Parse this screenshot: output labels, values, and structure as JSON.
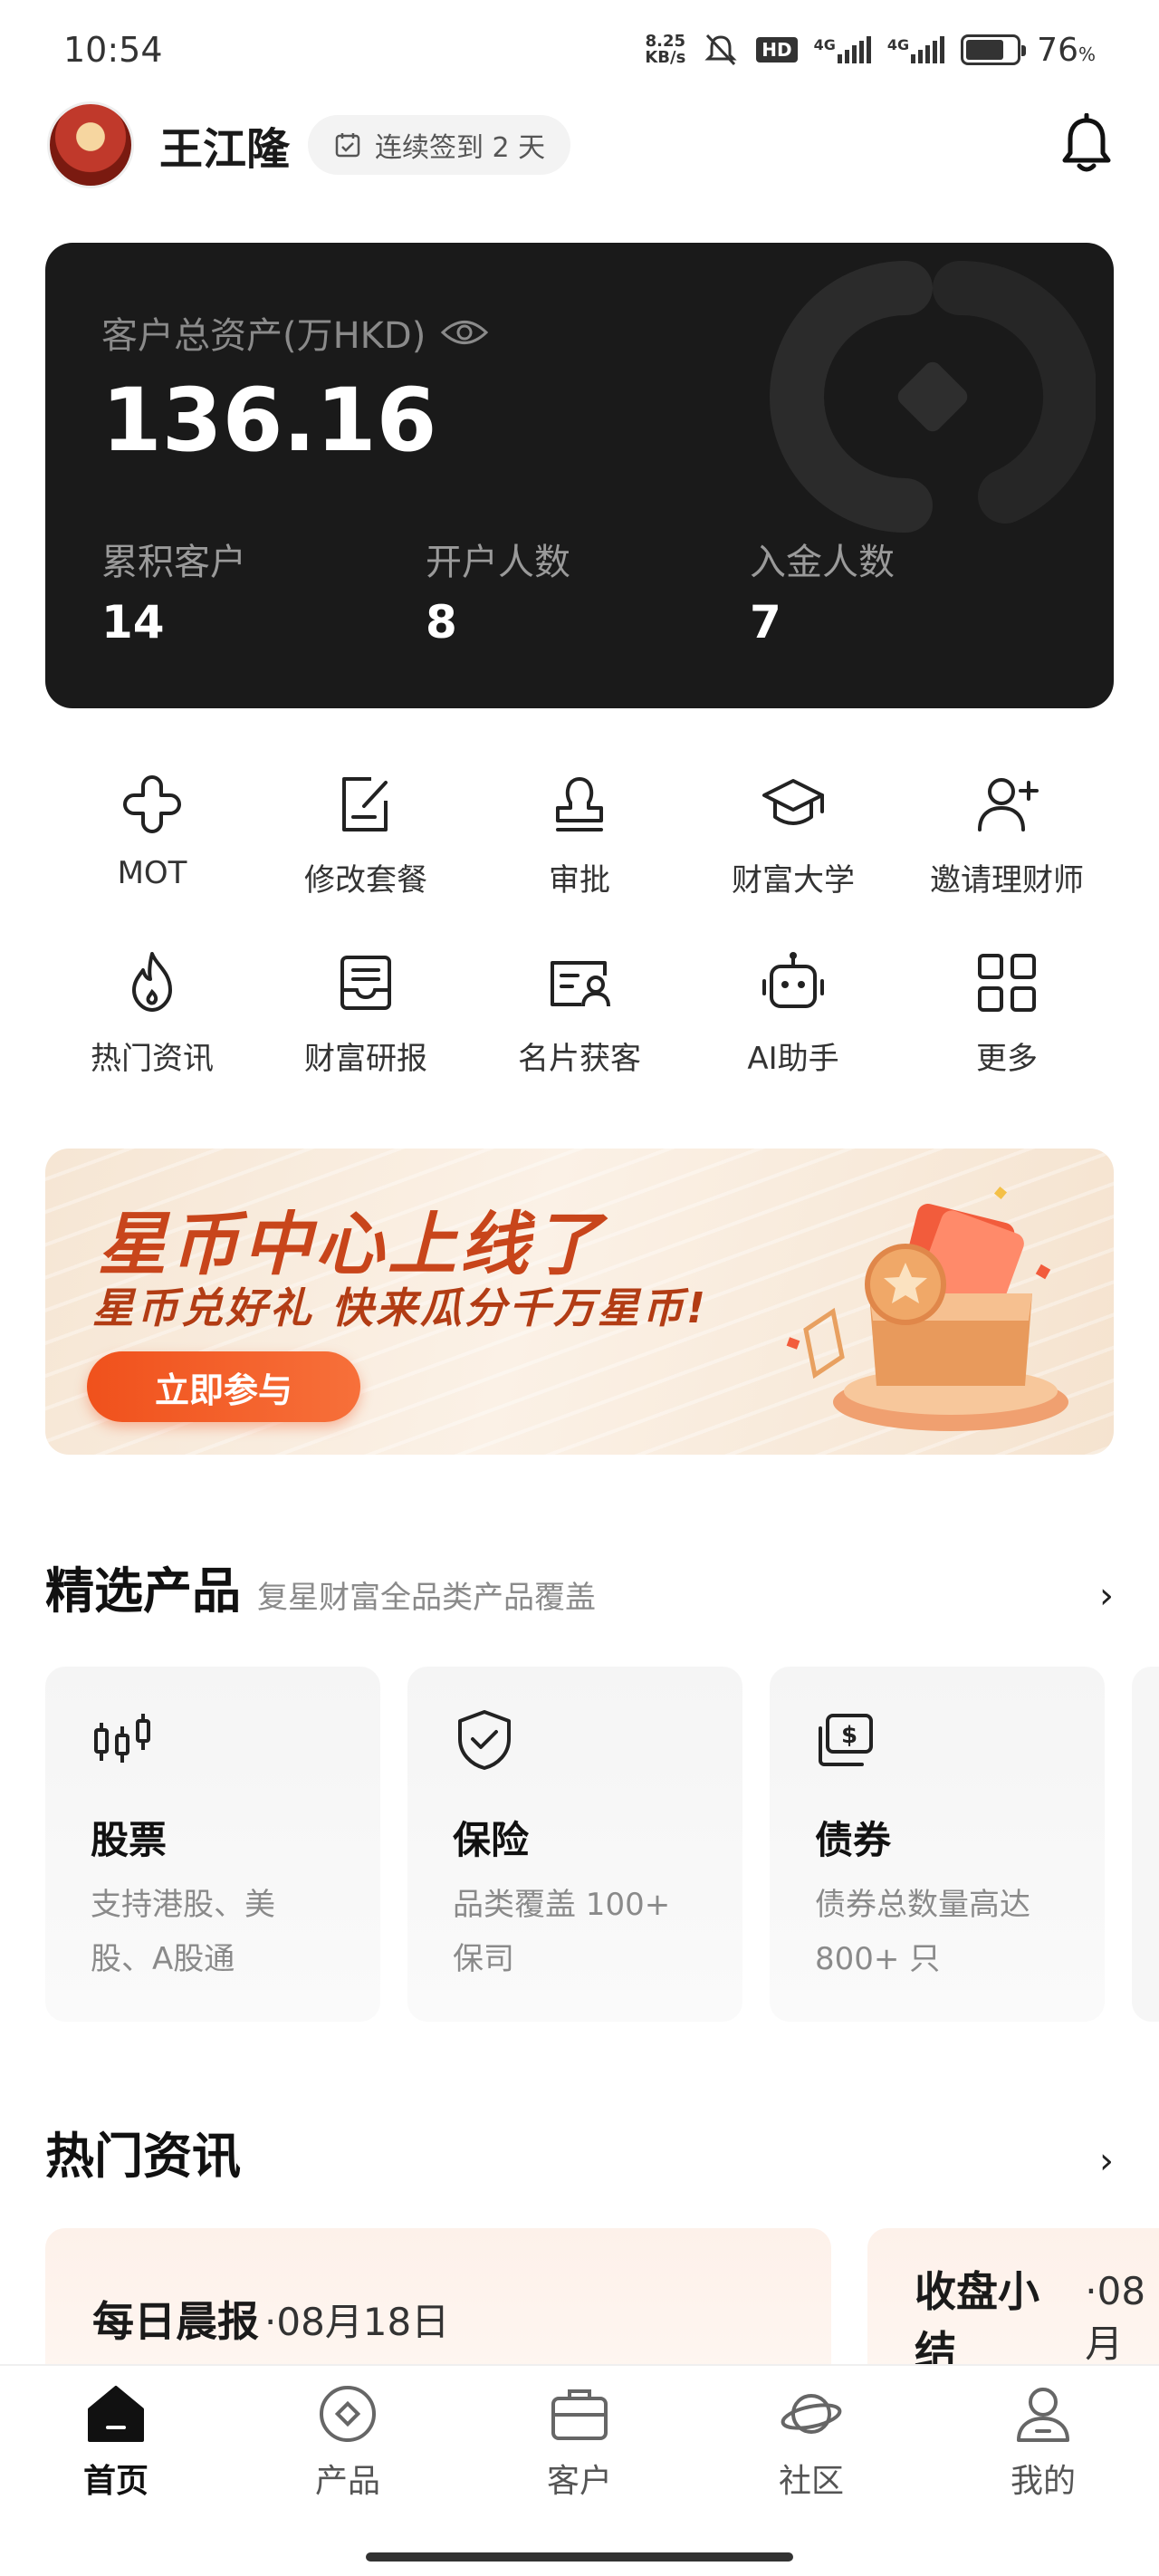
{
  "status_bar": {
    "time": "10:54",
    "net_speed_value": "8.25",
    "net_speed_unit": "KB/s",
    "hd": "HD",
    "network1": "4G",
    "network2": "4G",
    "battery_level": "76",
    "battery_unit": "%"
  },
  "header": {
    "username": "王江隆",
    "checkin_text": "连续签到 2 天"
  },
  "asset_card": {
    "label": "客户总资产(万HKD)",
    "value": "136.16",
    "stats": [
      {
        "label": "累积客户",
        "value": "14"
      },
      {
        "label": "开户人数",
        "value": "8"
      },
      {
        "label": "入金人数",
        "value": "7"
      }
    ]
  },
  "quick_actions": [
    {
      "label": "MOT",
      "icon": "clover-icon"
    },
    {
      "label": "修改套餐",
      "icon": "edit-document-icon"
    },
    {
      "label": "审批",
      "icon": "stamp-icon"
    },
    {
      "label": "财富大学",
      "icon": "graduation-cap-icon"
    },
    {
      "label": "邀请理财师",
      "icon": "add-user-icon"
    },
    {
      "label": "热门资讯",
      "icon": "flame-icon"
    },
    {
      "label": "财富研报",
      "icon": "inbox-report-icon"
    },
    {
      "label": "名片获客",
      "icon": "business-card-icon"
    },
    {
      "label": "AI助手",
      "icon": "robot-icon"
    },
    {
      "label": "更多",
      "icon": "grid-icon"
    }
  ],
  "banner": {
    "title": "星币中心上线了",
    "subtitle": "星币兑好礼 快来瓜分千万星币!",
    "button": "立即参与"
  },
  "products_section": {
    "title": "精选产品",
    "subtitle": "复星财富全品类产品覆盖",
    "items": [
      {
        "title": "股票",
        "desc": "支持港股、美股、A股通",
        "icon": "candlestick-icon"
      },
      {
        "title": "保险",
        "desc": "品类覆盖 100+ 保司",
        "icon": "shield-check-icon"
      },
      {
        "title": "债券",
        "desc": "债券总数量高达 800+ 只",
        "icon": "money-bill-icon"
      }
    ]
  },
  "news_section": {
    "title": "热门资讯",
    "items": [
      {
        "title": "每日晨报",
        "date": "·08月18日"
      },
      {
        "title": "收盘小结",
        "date": "·08月"
      }
    ]
  },
  "tabbar": {
    "items": [
      {
        "label": "首页",
        "icon": "home-icon",
        "active": true
      },
      {
        "label": "产品",
        "icon": "product-icon",
        "active": false
      },
      {
        "label": "客户",
        "icon": "briefcase-icon",
        "active": false
      },
      {
        "label": "社区",
        "icon": "planet-icon",
        "active": false
      },
      {
        "label": "我的",
        "icon": "profile-icon",
        "active": false
      }
    ]
  },
  "colors": {
    "accent": "#f0511c",
    "card_dark": "#1a1a1a",
    "banner_title": "#c8451b"
  }
}
